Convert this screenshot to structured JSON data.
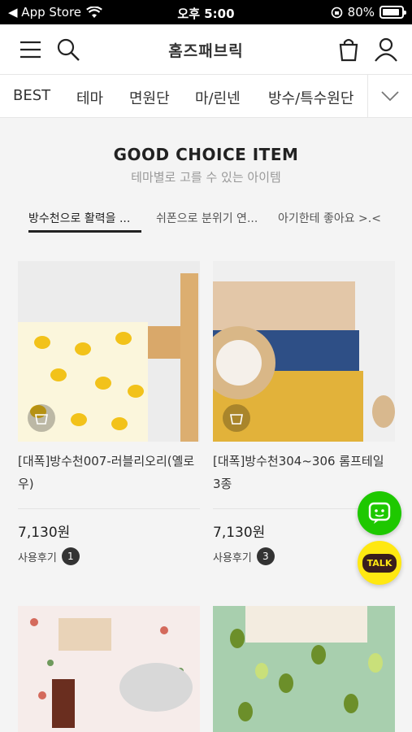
{
  "status_bar": {
    "back_app": "◀ App Store",
    "time": "오후 5:00",
    "battery": "80%"
  },
  "header": {
    "logo": "홈즈패브릭"
  },
  "category_nav": {
    "items": [
      "BEST",
      "테마",
      "면원단",
      "마/린넨",
      "방수/특수원단"
    ]
  },
  "section": {
    "title": "GOOD CHOICE ITEM",
    "subtitle": "테마별로 고를 수 있는 아이템"
  },
  "tabs": [
    {
      "label": "방수천으로 활력을 ...",
      "active": true
    },
    {
      "label": "쉬폰으로 분위기 연...",
      "active": false
    },
    {
      "label": "아기한테 좋아요 >.<",
      "active": false
    }
  ],
  "products": [
    {
      "title": "[대폭]방수천007-러블리오리(옐로우)",
      "price": "7,130원",
      "review_label": "사용후기",
      "review_count": "1"
    },
    {
      "title": "[대폭]방수천304~306 롬프테일 3종",
      "price": "7,130원",
      "review_label": "사용후기",
      "review_count": "3"
    }
  ],
  "floating": {
    "kakao_label": "TALK"
  },
  "colors": {
    "accent_green": "#1ec800",
    "kakao_yellow": "#ffe812"
  }
}
